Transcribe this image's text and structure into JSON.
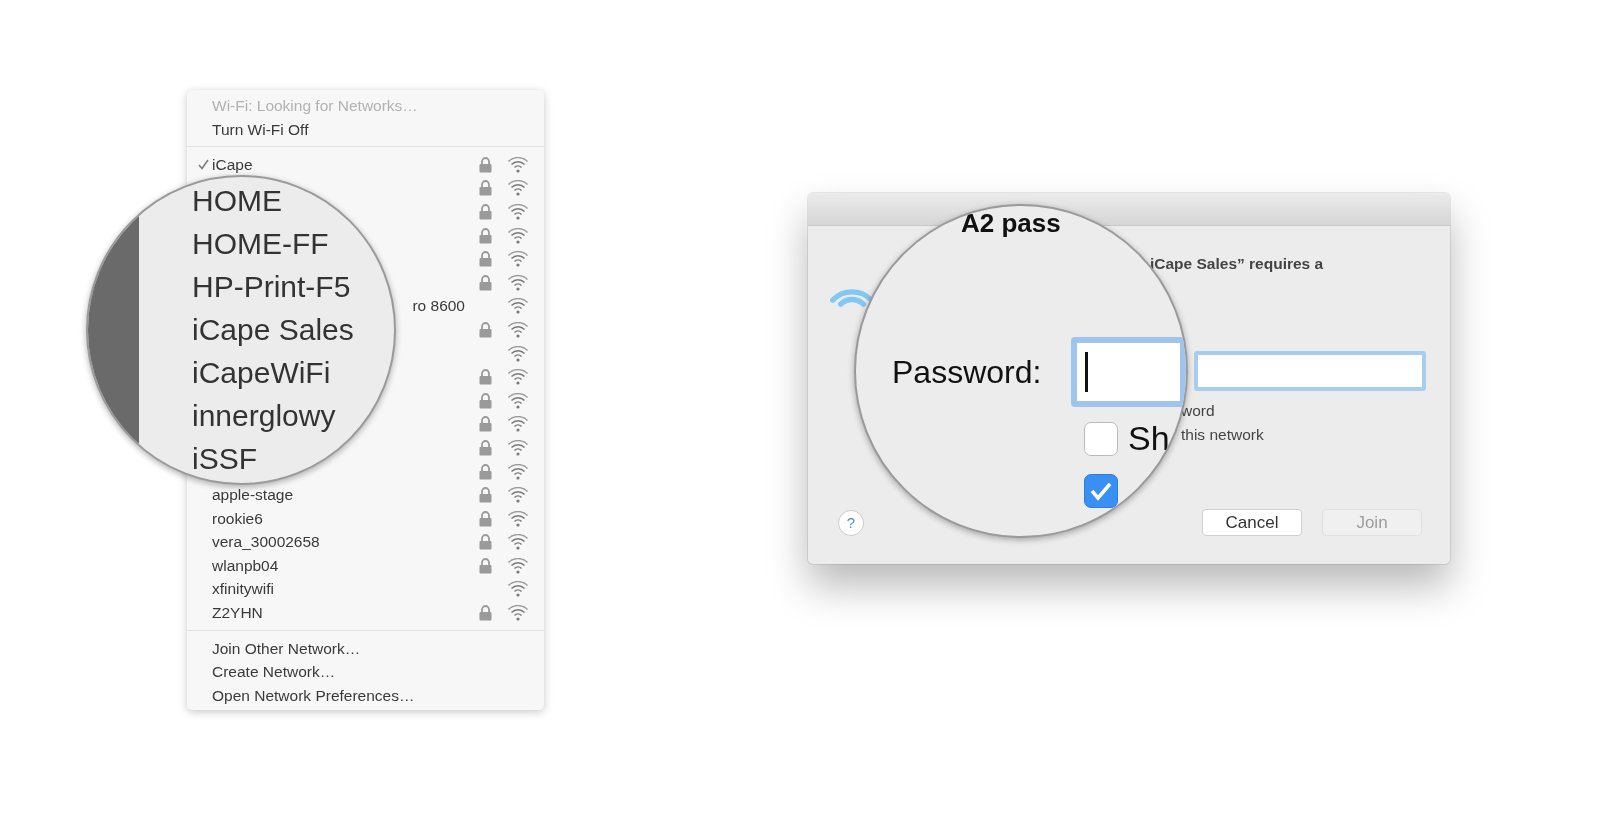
{
  "wifi_menu": {
    "status": "Wi-Fi: Looking for Networks…",
    "toggle": "Turn Wi-Fi Off",
    "networks": [
      {
        "name": "iCape",
        "kind": "plain",
        "selected": true,
        "locked": true
      },
      {
        "kind": "hidden",
        "selected": false,
        "locked": true
      },
      {
        "kind": "hidden",
        "selected": false,
        "locked": true
      },
      {
        "kind": "hidden",
        "selected": false,
        "locked": true
      },
      {
        "kind": "hidden",
        "selected": false,
        "locked": true
      },
      {
        "kind": "hidden",
        "selected": false,
        "locked": true
      },
      {
        "name": "ro 8600",
        "kind": "tail",
        "selected": false,
        "locked": false
      },
      {
        "kind": "hidden",
        "selected": false,
        "locked": true
      },
      {
        "kind": "hidden",
        "selected": false,
        "locked": false
      },
      {
        "kind": "hidden",
        "selected": false,
        "locked": true
      },
      {
        "kind": "hidden",
        "selected": false,
        "locked": true
      },
      {
        "kind": "hidden",
        "selected": false,
        "locked": true
      },
      {
        "kind": "hidden",
        "selected": false,
        "locked": true
      },
      {
        "kind": "hidden",
        "selected": false,
        "locked": true
      },
      {
        "name": "apple-stage",
        "kind": "plain",
        "selected": false,
        "locked": true
      },
      {
        "name": "rookie6",
        "kind": "plain",
        "selected": false,
        "locked": true
      },
      {
        "name": "vera_30002658",
        "kind": "plain",
        "selected": false,
        "locked": true
      },
      {
        "name": "wlanpb04",
        "kind": "plain",
        "selected": false,
        "locked": true
      },
      {
        "name": "xfinitywifi",
        "kind": "plain",
        "selected": false,
        "locked": false
      },
      {
        "name": "Z2YHN",
        "kind": "plain",
        "selected": false,
        "locked": true
      }
    ],
    "actions": [
      "Join Other Network…",
      "Create Network…",
      "Open Network Preferences…"
    ]
  },
  "menu_magnifier": {
    "lines": [
      "HOME",
      "HOME-FF",
      "HP-Print-F5",
      "iCape Sales",
      "iCapeWiFi",
      "innerglowy",
      "iSSF"
    ]
  },
  "join_dialog": {
    "message": "iCape Sales” requires a",
    "show_password_label": "word",
    "remember_label": "this network",
    "help": "?",
    "buttons": [
      {
        "label": "Cancel",
        "disabled": false
      },
      {
        "label": "Join",
        "disabled": true
      }
    ]
  },
  "dialog_magnifier": {
    "heading": "A2 pass",
    "password_label": "Password:",
    "show_password": {
      "label": "Sh",
      "checked": false
    },
    "remember": {
      "checked": true
    }
  }
}
